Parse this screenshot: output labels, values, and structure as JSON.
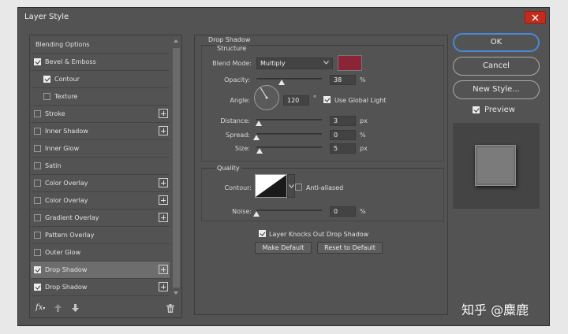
{
  "window": {
    "title": "Layer Style"
  },
  "styles_list": [
    {
      "label": "Blending Options",
      "checkbox": false,
      "checked": false,
      "indent": false,
      "plus": false,
      "selected": false
    },
    {
      "label": "Bevel & Emboss",
      "checkbox": true,
      "checked": true,
      "indent": false,
      "plus": false,
      "selected": false
    },
    {
      "label": "Contour",
      "checkbox": true,
      "checked": true,
      "indent": true,
      "plus": false,
      "selected": false
    },
    {
      "label": "Texture",
      "checkbox": true,
      "checked": false,
      "indent": true,
      "plus": false,
      "selected": false
    },
    {
      "label": "Stroke",
      "checkbox": true,
      "checked": false,
      "indent": false,
      "plus": true,
      "selected": false
    },
    {
      "label": "Inner Shadow",
      "checkbox": true,
      "checked": false,
      "indent": false,
      "plus": true,
      "selected": false
    },
    {
      "label": "Inner Glow",
      "checkbox": true,
      "checked": false,
      "indent": false,
      "plus": false,
      "selected": false
    },
    {
      "label": "Satin",
      "checkbox": true,
      "checked": false,
      "indent": false,
      "plus": false,
      "selected": false
    },
    {
      "label": "Color Overlay",
      "checkbox": true,
      "checked": false,
      "indent": false,
      "plus": true,
      "selected": false
    },
    {
      "label": "Color Overlay",
      "checkbox": true,
      "checked": false,
      "indent": false,
      "plus": true,
      "selected": false
    },
    {
      "label": "Gradient Overlay",
      "checkbox": true,
      "checked": false,
      "indent": false,
      "plus": true,
      "selected": false
    },
    {
      "label": "Pattern Overlay",
      "checkbox": true,
      "checked": false,
      "indent": false,
      "plus": false,
      "selected": false
    },
    {
      "label": "Outer Glow",
      "checkbox": true,
      "checked": false,
      "indent": false,
      "plus": false,
      "selected": false
    },
    {
      "label": "Drop Shadow",
      "checkbox": true,
      "checked": true,
      "indent": false,
      "plus": true,
      "selected": true
    },
    {
      "label": "Drop Shadow",
      "checkbox": true,
      "checked": true,
      "indent": false,
      "plus": true,
      "selected": false
    }
  ],
  "bottom_toolbar": {
    "fx_label": "fx"
  },
  "drop_shadow": {
    "section_title": "Drop Shadow",
    "structure_title": "Structure",
    "blend_mode_label": "Blend Mode:",
    "blend_mode_value": "Multiply",
    "shadow_color": "#8b2434",
    "opacity_label": "Opacity:",
    "opacity_value": "38",
    "opacity_unit": "%",
    "opacity_level": 0.38,
    "angle_label": "Angle:",
    "angle_value": "120",
    "angle_unit": "°",
    "use_global_light_label": "Use Global Light",
    "use_global_light_checked": true,
    "distance_label": "Distance:",
    "distance_value": "3",
    "distance_unit": "px",
    "spread_label": "Spread:",
    "spread_value": "0",
    "spread_unit": "%",
    "size_label": "Size:",
    "size_value": "5",
    "size_unit": "px",
    "quality_title": "Quality",
    "contour_label": "Contour:",
    "anti_aliased_label": "Anti-aliased",
    "anti_aliased_checked": false,
    "noise_label": "Noise:",
    "noise_value": "0",
    "noise_unit": "%",
    "layer_knocks_out_label": "Layer Knocks Out Drop Shadow",
    "layer_knocks_out_checked": true,
    "make_default_label": "Make Default",
    "reset_default_label": "Reset to Default"
  },
  "actions": {
    "ok_label": "OK",
    "cancel_label": "Cancel",
    "new_style_label": "New Style...",
    "preview_label": "Preview",
    "preview_checked": true
  },
  "watermark": {
    "text": "知乎 @麋鹿"
  },
  "colors": {
    "accent": "#4a88d8",
    "close_button": "#c42b1c",
    "panel_bg": "#535353"
  }
}
